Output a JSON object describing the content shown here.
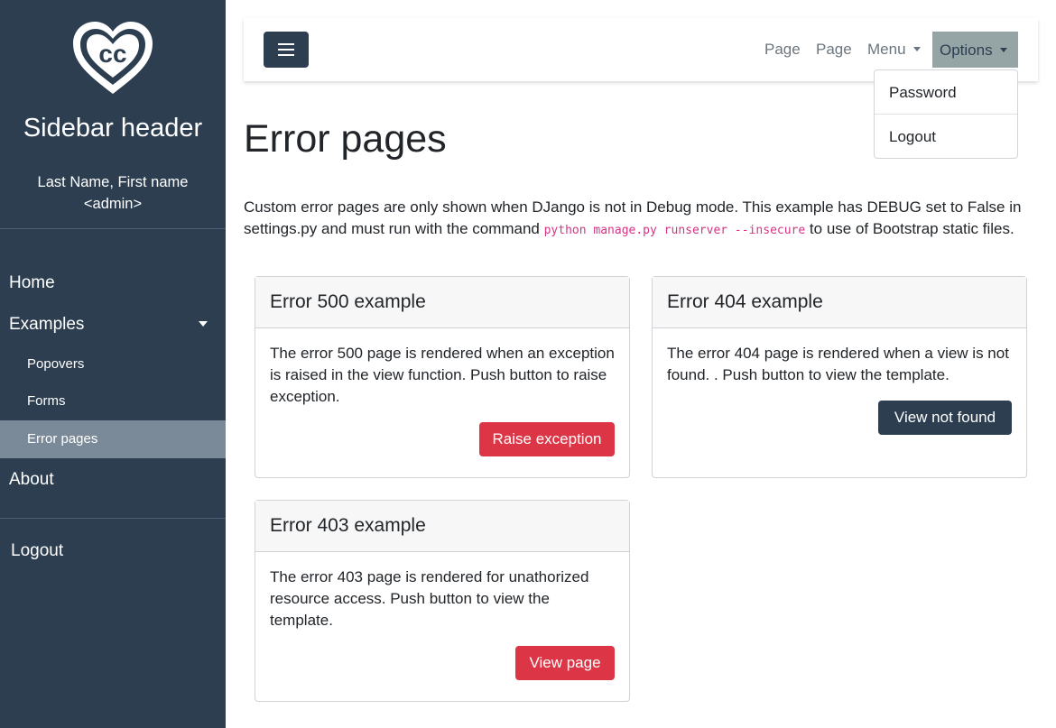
{
  "sidebar": {
    "header": "Sidebar header",
    "user_line1": "Last Name, First name",
    "user_line2": "<admin>",
    "home": "Home",
    "examples": "Examples",
    "sub_items": [
      "Popovers",
      "Forms",
      "Error pages"
    ],
    "about": "About",
    "logout": "Logout"
  },
  "navbar": {
    "links": [
      "Page",
      "Page"
    ],
    "menu": "Menu",
    "options": "Options",
    "dropdown": [
      "Password",
      "Logout"
    ]
  },
  "main": {
    "title": "Error pages",
    "intro_before": "Custom error pages are only shown when DJango is not in Debug mode. This example has DEBUG set to False in settings.py and must run with the command ",
    "intro_code": "python manage.py runserver --insecure",
    "intro_after": " to use of Bootstrap static files.",
    "cards": [
      {
        "title": "Error 500 example",
        "text": "The error 500 page is rendered when an exception is raised in the view function. Push button to raise exception.",
        "button": "Raise exception"
      },
      {
        "title": "Error 404 example",
        "text": "The error 404 page is rendered when a view is not found. . Push button to view the template.",
        "button": "View not found"
      },
      {
        "title": "Error 403 example",
        "text": "The error 403 page is rendered for unathorized resource access. Push button to view the template.",
        "button": "View page"
      }
    ]
  },
  "colors": {
    "sidebar_bg": "#2c3e50",
    "danger": "#dc3545",
    "dark": "#2c3e50",
    "options_bg": "#95a5a6"
  }
}
